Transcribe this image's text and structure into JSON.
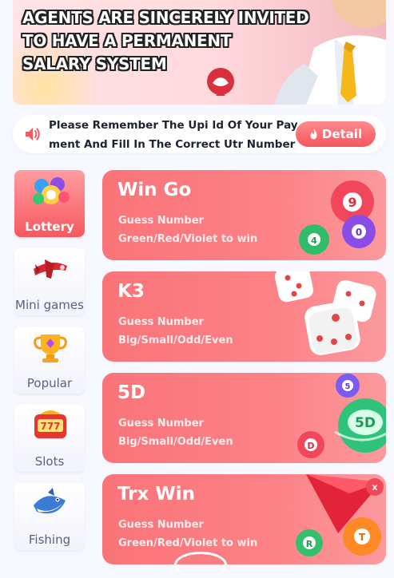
{
  "banner": {
    "lines": [
      "AGENTS ARE SINCERELY INVITED",
      "TO HAVE A PERMANENT",
      "SALARY SYSTEM"
    ]
  },
  "notice": {
    "text": "Please Remember The Upi Id Of Your Payment And Fill In The Correct Utr Number And",
    "detail_label": "Detail",
    "icon": "speaker-icon"
  },
  "categories": [
    {
      "label": "Lottery",
      "icon": "lottery-balls-icon",
      "active": true
    },
    {
      "label": "Mini games",
      "icon": "plane-icon",
      "active": false
    },
    {
      "label": "Popular",
      "icon": "trophy-icon",
      "active": false
    },
    {
      "label": "Slots",
      "icon": "slot-machine-icon",
      "active": false
    },
    {
      "label": "Fishing",
      "icon": "shark-icon",
      "active": false
    }
  ],
  "games": [
    {
      "title": "Win Go",
      "line1": "Guess Number",
      "line2": "Green/Red/Violet to win",
      "art": "lottery-balls-icon"
    },
    {
      "title": "K3",
      "line1": "Guess Number",
      "line2": "Big/Small/Odd/Even",
      "art": "dice-icon"
    },
    {
      "title": "5D",
      "line1": "Guess Number",
      "line2": "Big/Small/Odd/Even",
      "art": "5d-ball-icon"
    },
    {
      "title": "Trx Win",
      "line1": "Guess Number",
      "line2": "Green/Red/Violet to win",
      "art": "trx-balls-icon"
    }
  ],
  "colors": {
    "accent": "#f7585e",
    "card_bg": "#fb7f84",
    "page_bg": "#f7f8ff"
  }
}
